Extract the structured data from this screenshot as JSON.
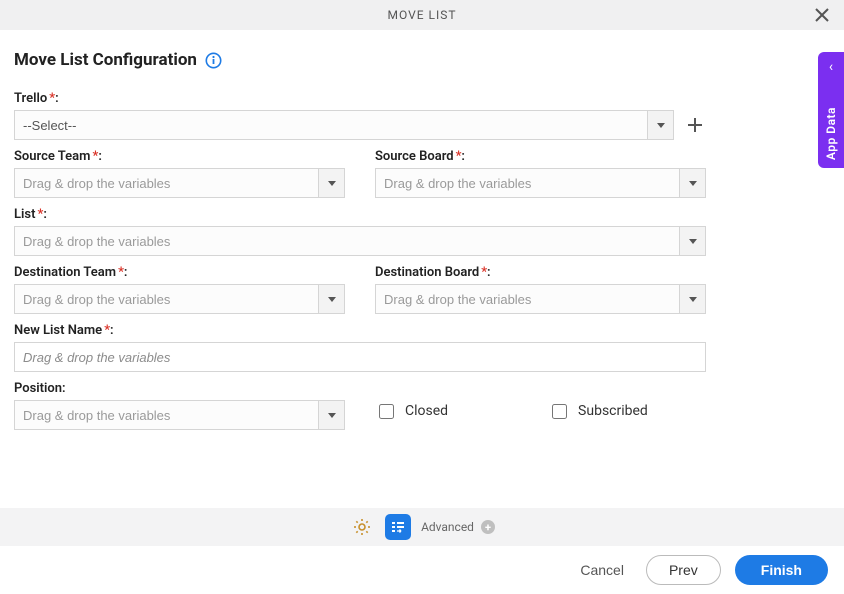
{
  "header": {
    "title": "MOVE LIST"
  },
  "page_title": "Move List Configuration",
  "side_tab": {
    "label": "App Data"
  },
  "fields": {
    "trello": {
      "label": "Trello",
      "required": true,
      "value": "--Select--"
    },
    "source_team": {
      "label": "Source Team",
      "required": true,
      "placeholder": "Drag & drop the variables"
    },
    "source_board": {
      "label": "Source Board",
      "required": true,
      "placeholder": "Drag & drop the variables"
    },
    "list": {
      "label": "List",
      "required": true,
      "placeholder": "Drag & drop the variables"
    },
    "dest_team": {
      "label": "Destination Team",
      "required": true,
      "placeholder": "Drag & drop the variables"
    },
    "dest_board": {
      "label": "Destination Board",
      "required": true,
      "placeholder": "Drag & drop the variables"
    },
    "new_list_name": {
      "label": "New List Name",
      "required": true,
      "placeholder": "Drag & drop the variables"
    },
    "position": {
      "label": "Position",
      "required": false,
      "placeholder": "Drag & drop the variables"
    },
    "closed": {
      "label": "Closed",
      "checked": false
    },
    "subscribed": {
      "label": "Subscribed",
      "checked": false
    }
  },
  "toolbar": {
    "advanced": "Advanced"
  },
  "footer": {
    "cancel": "Cancel",
    "prev": "Prev",
    "finish": "Finish"
  }
}
